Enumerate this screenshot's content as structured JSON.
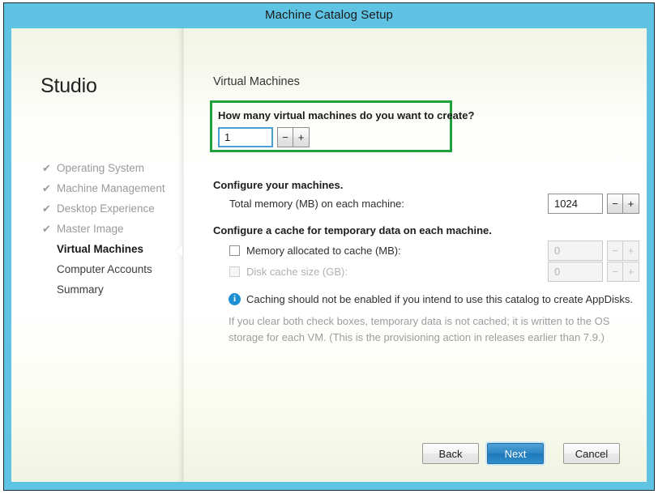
{
  "window": {
    "title": "Machine Catalog Setup",
    "titlebar_color": "#5fc3e4"
  },
  "sidebar": {
    "brand": "Studio",
    "check_glyph": "✔",
    "items": [
      {
        "label": "Operating System",
        "state": "done"
      },
      {
        "label": "Machine Management",
        "state": "done"
      },
      {
        "label": "Desktop Experience",
        "state": "done"
      },
      {
        "label": "Master Image",
        "state": "done"
      },
      {
        "label": "Virtual Machines",
        "state": "current"
      },
      {
        "label": "Computer Accounts",
        "state": "upcoming"
      },
      {
        "label": "Summary",
        "state": "upcoming"
      }
    ]
  },
  "main": {
    "section_title": "Virtual Machines",
    "highlight_color": "#22a03c",
    "vm_count": {
      "question": "How many virtual machines do you want to create?",
      "value": "1",
      "decrement_label": "−",
      "increment_label": "+"
    },
    "configure_machines": {
      "heading": "Configure your machines.",
      "memory_label": "Total memory (MB) on each machine:",
      "memory_value": "1024",
      "decrement_label": "−",
      "increment_label": "+"
    },
    "cache": {
      "heading": "Configure a cache for temporary data on each machine.",
      "memory_cache_label": "Memory allocated to cache (MB):",
      "memory_cache_value": "0",
      "memory_cache_checked": false,
      "disk_cache_label": "Disk cache size (GB):",
      "disk_cache_value": "0",
      "disk_cache_checked": false,
      "decrement_label": "−",
      "increment_label": "+"
    },
    "info": {
      "icon_glyph": "i",
      "message": "Caching should not be enabled if you intend to use this catalog to create AppDisks.",
      "note": "If you clear both check boxes, temporary data is not cached; it is written to the OS storage for each VM. (This is the provisioning action in releases earlier than 7.9.)"
    }
  },
  "footer": {
    "back_label": "Back",
    "next_label": "Next",
    "cancel_label": "Cancel"
  }
}
